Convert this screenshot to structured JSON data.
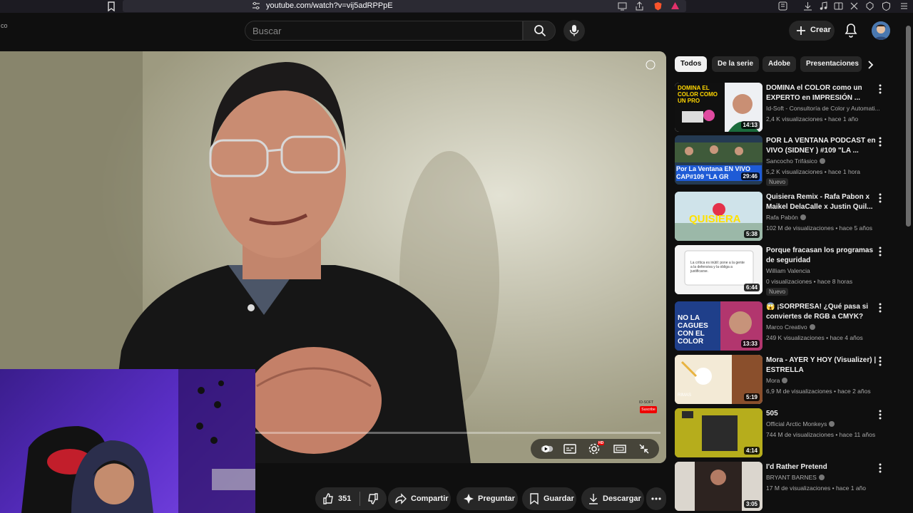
{
  "browser": {
    "url": "youtube.com/watch?v=vij5adRPPpE",
    "icons": [
      "bookmark-icon",
      "tune-icon",
      "reader-icon",
      "share-icon",
      "brave-shield-icon",
      "rewards-icon",
      "sidebar-icon",
      "download-icon",
      "music-icon",
      "wallet-icon",
      "extensions-icon",
      "vpn-icon"
    ]
  },
  "youtube": {
    "logo_fragment": "co",
    "search_placeholder": "Buscar",
    "create_label": "Crear"
  },
  "player": {
    "watermark": "ID-SOFT",
    "subscribe_tag": "Suscribe",
    "hd_badge": "HD"
  },
  "actions": {
    "like_count": "351",
    "share_label": "Compartir",
    "ask_label": "Preguntar",
    "save_label": "Guardar",
    "download_label": "Descargar"
  },
  "sidebar": {
    "chips": [
      "Todos",
      "De la serie",
      "Adobe",
      "Presentaciones"
    ],
    "recommendations": [
      {
        "title": "DOMINA el COLOR como un EXPERTO en IMPRESIÓN ...",
        "channel": "Id-Soft - Consultoría de Color y Automati...",
        "meta": "2,4 K visualizaciones • hace 1 año",
        "duration": "14:13",
        "thumb_text": "DOMINA EL COLOR COMO UN PRO",
        "new": ""
      },
      {
        "title": "POR LA VENTANA PODCAST en VIVO (SIDNEY ) #109 \"LA ...",
        "channel": "Sancocho Trifásico",
        "meta": "5,2 K visualizaciones • hace 1 hora",
        "duration": "29:46",
        "thumb_text": "Por La Ventana EN VIVO CAP#109 \"LA GR",
        "new": "Nuevo"
      },
      {
        "title": "Quisiera Remix - Rafa Pabon x Maikel DelaCalle x Justin Quil...",
        "channel": "Rafa Pabón",
        "meta": "102 M de visualizaciones • hace 5 años",
        "duration": "5:38",
        "thumb_text": "QUISIERA",
        "new": ""
      },
      {
        "title": "Porque fracasan los programas de seguridad",
        "channel": "William Valencia",
        "meta": "0 visualizaciones • hace 8 horas",
        "duration": "6:44",
        "thumb_text": "La crítica es inútil: pone a la gente a la defensiva y la obliga a justificarse.",
        "new": "Nuevo"
      },
      {
        "title": "😱 ¡SORPRESA! ¿Qué pasa si conviertes de RGB a CMYK?",
        "channel": "Marco Creativo",
        "meta": "249 K visualizaciones • hace 4 años",
        "duration": "13:33",
        "thumb_text": "NO LA CAGUES CON EL COLOR",
        "new": ""
      },
      {
        "title": "Mora - AYER Y HOY (Visualizer) | ESTRELLA",
        "channel": "Mora",
        "meta": "6,9 M de visualizaciones • hace 2 años",
        "duration": "5:19",
        "thumb_text": "RIMAS",
        "new": ""
      },
      {
        "title": "505",
        "channel": "Official Arctic Monkeys",
        "meta": "744 M de visualizaciones • hace 11 años",
        "duration": "4:14",
        "thumb_text": "",
        "new": ""
      },
      {
        "title": "I'd Rather Pretend",
        "channel": "BRYANT BARNES",
        "meta": "17 M de visualizaciones • hace 1 año",
        "duration": "3:05",
        "thumb_text": "",
        "new": ""
      }
    ]
  },
  "colors": {
    "background": "#0f0f0f",
    "chip_active": "#f1f1f1",
    "accent_red": "#ff0000",
    "webcam_purple": "#5b2fc8"
  }
}
